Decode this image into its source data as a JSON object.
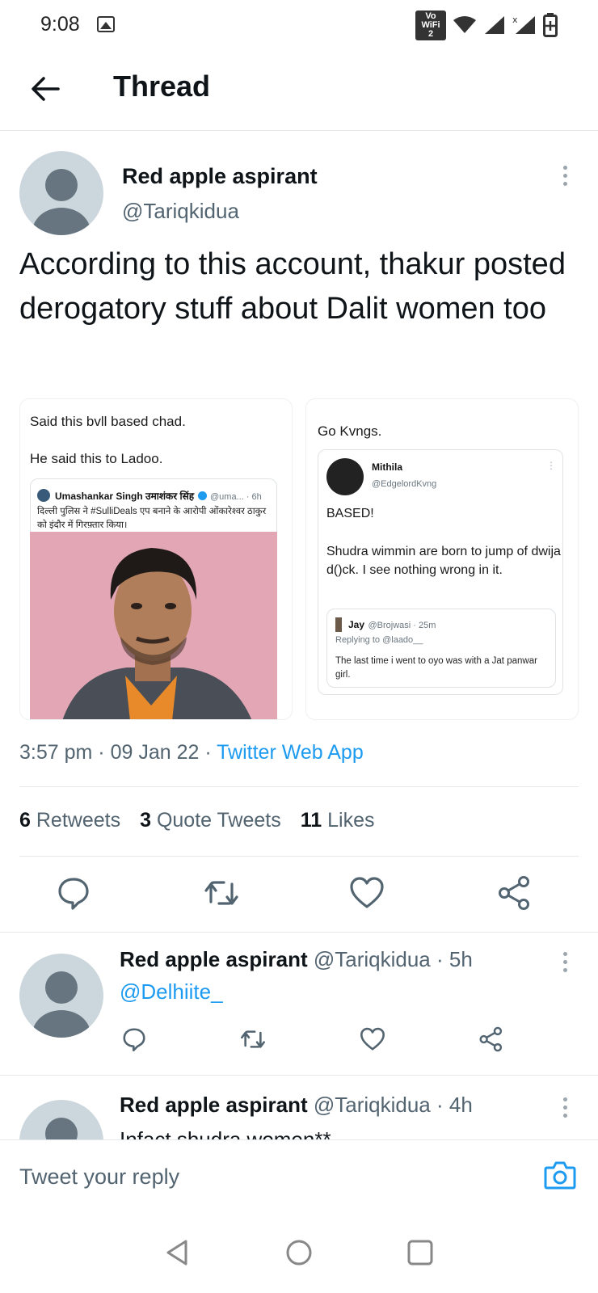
{
  "status_bar": {
    "time": "9:08",
    "vowifi": "Vo WiFi 2",
    "wifi_icon": "wifi-icon",
    "signal_icon": "signal-icon",
    "battery_icon": "battery-icon"
  },
  "header": {
    "title": "Thread"
  },
  "main_tweet": {
    "name": "Red apple aspirant",
    "handle": "@Tariqkidua",
    "text": "According to this account, thakur posted derogatory stuff about Dalit women too",
    "media_left": {
      "line1": "Said this bvll based chad.",
      "line2": "He said this to Ladoo.",
      "quote_name": "Umashankar Singh उमाशंकर सिंह",
      "quote_meta": "@uma... · 6h",
      "quote_text": "दिल्ली पुलिस ने #SulliDeals एप बनाने के आरोपी ओंकारेश्वर ठाकुर को इंदौर में गिरफ़्तार किया।"
    },
    "media_right": {
      "line1": "Go Kvngs.",
      "quote_name": "Mithila",
      "quote_handle": "@EdgelordKvng",
      "quote_text1": "BASED!",
      "quote_text2": "Shudra wimmin are born to jump of dwija d()ck. I see nothing wrong in it.",
      "inner_name": "Jay",
      "inner_meta": "@Brojwasi · 25m",
      "inner_reply": "Replying to @laado__",
      "inner_text": "The last time i went to oyo was with a Jat panwar girl."
    },
    "time": "3:57 pm",
    "date": "09 Jan 22",
    "source": "Twitter Web App",
    "retweets_count": "6",
    "retweets_label": "Retweets",
    "quotes_count": "3",
    "quotes_label": "Quote Tweets",
    "likes_count": "11",
    "likes_label": "Likes"
  },
  "replies": [
    {
      "name": "Red apple aspirant",
      "handle": "@Tariqkidua",
      "time": "· 5h",
      "text": "@Delhiite_"
    },
    {
      "name": "Red apple aspirant",
      "handle": "@Tariqkidua",
      "time": "· 4h",
      "text": "Infact shudra women**"
    }
  ],
  "reply_box": {
    "placeholder": "Tweet your reply"
  },
  "colors": {
    "accent": "#1d9bf0",
    "text": "#0f1419",
    "secondary": "#536471"
  }
}
